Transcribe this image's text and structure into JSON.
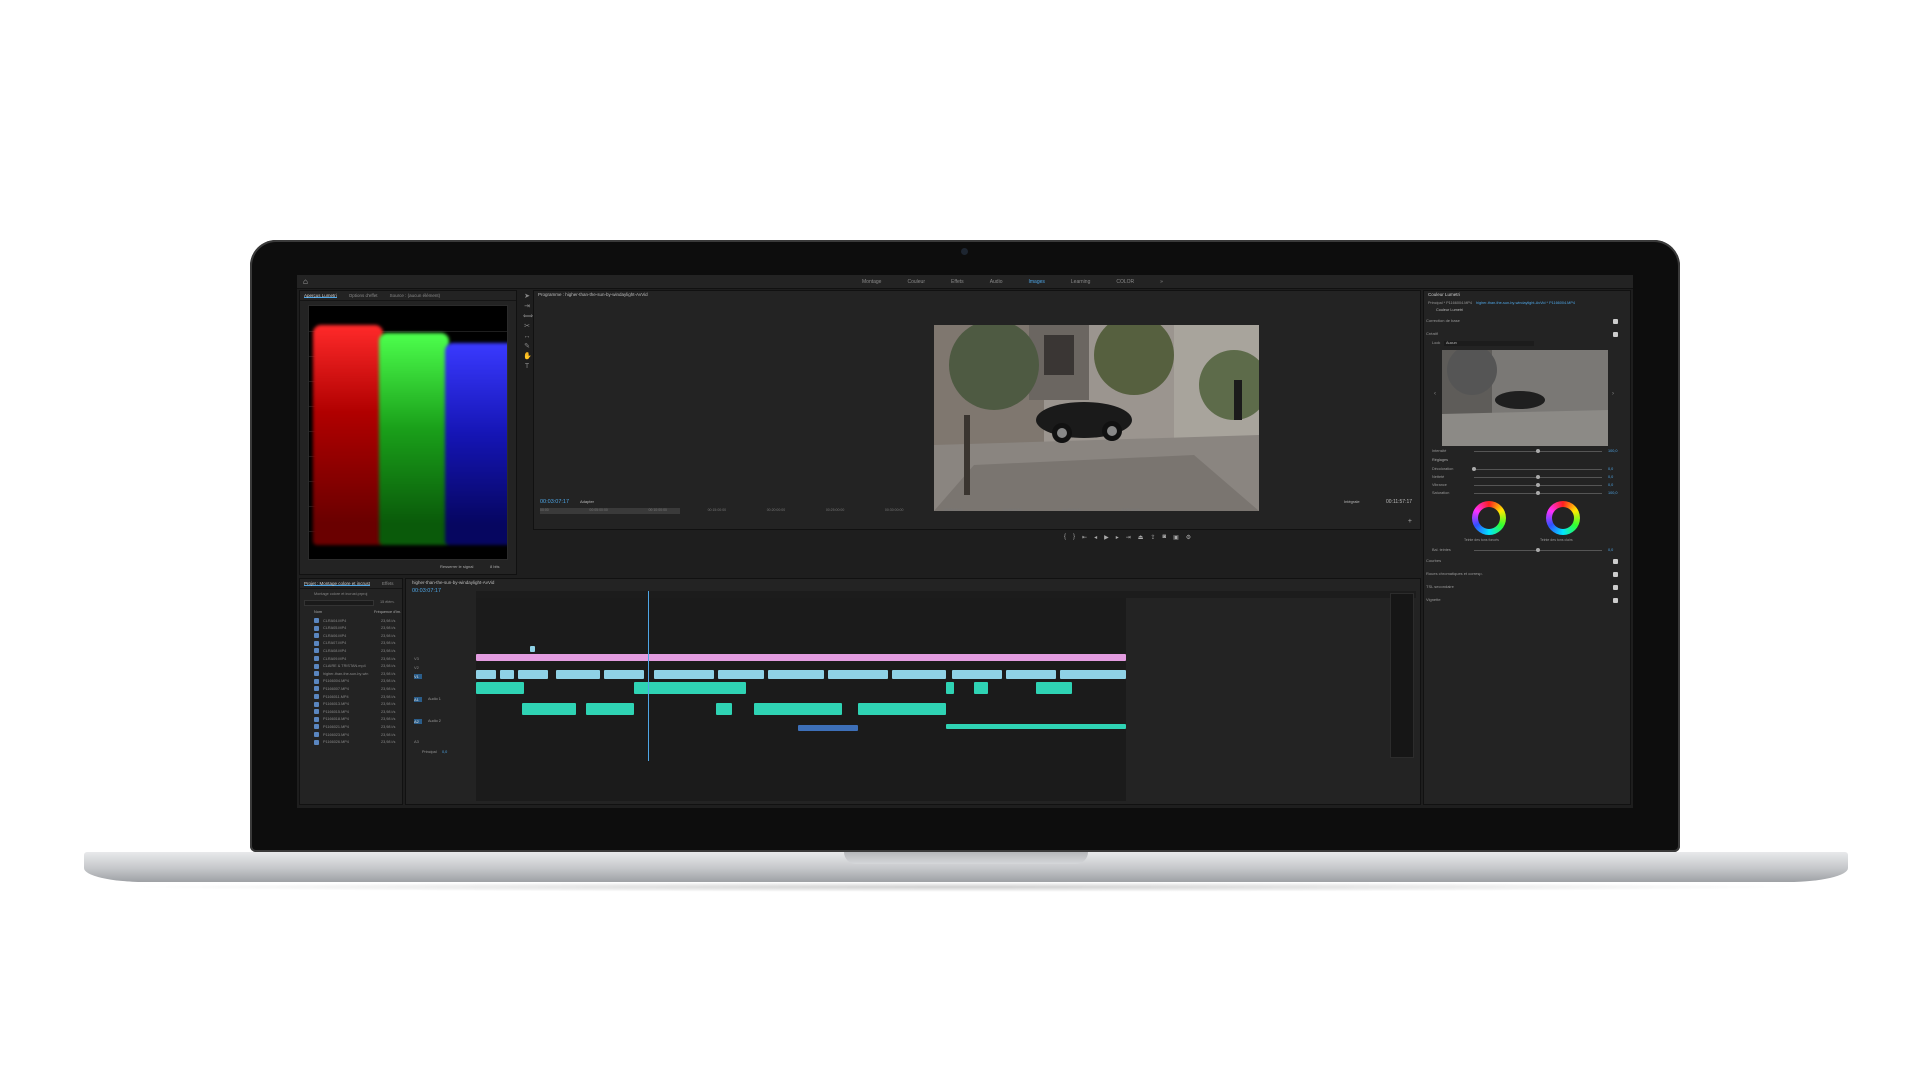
{
  "app": {
    "workspaces": [
      "Montage",
      "Couleur",
      "Effets",
      "Audio",
      "Images",
      "Learning",
      "COLOR"
    ],
    "active_workspace": "Images",
    "overflow": "»"
  },
  "scopes_panel": {
    "tabs": [
      "Aperçus Lumetri",
      "Options d'effet",
      "Source : (aucun élément)"
    ],
    "footer_label": "Resserrer le signal",
    "footer_value": "8 bits"
  },
  "program_monitor": {
    "title": "Programme : higher-than-the-sun-by-windaylight-AvVid",
    "timecode": "00:03:07:17",
    "fit": "Adapter",
    "quality": "Intégrale",
    "duration": "00:11:57:17",
    "ruler_ticks": [
      "00:00",
      "00:05:00:00",
      "00:10:00:00",
      "00:15:00:00",
      "00:20:00:00",
      "00:25:00:00",
      "00:30:00:00",
      "00:35:00:00",
      "00:40:00:00",
      "00:45:00:00",
      "00:50:00:00"
    ]
  },
  "project_panel": {
    "title": "Projet : Montage colore et incrust",
    "tab2": "Effets",
    "bin_label": "Montage colore et incrust.prproj",
    "count": "15 élém.",
    "col_name": "Nom",
    "col_rate": "Fréquence d'im.",
    "items": [
      {
        "name": "CLRA04.MP4",
        "rate": "23,98 i/s"
      },
      {
        "name": "CLRA05.MP4",
        "rate": "23,98 i/s"
      },
      {
        "name": "CLRA06.MP4",
        "rate": "23,98 i/s"
      },
      {
        "name": "CLRA07.MP4",
        "rate": "23,98 i/s"
      },
      {
        "name": "CLRA08.MP4",
        "rate": "23,98 i/s"
      },
      {
        "name": "CLRA09.MP4",
        "rate": "23,98 i/s"
      },
      {
        "name": "CLAIRE & TRISTAN.mp4",
        "rate": "23,98 i/s"
      },
      {
        "name": "higher-than-the-sun-by-win",
        "rate": "23,98 i/s"
      },
      {
        "name": "P1166004.MP4",
        "rate": "23,98 i/s"
      },
      {
        "name": "P1166007.MP4",
        "rate": "23,98 i/s"
      },
      {
        "name": "P1166011.MP4",
        "rate": "23,98 i/s"
      },
      {
        "name": "P1166013.MP4",
        "rate": "23,98 i/s"
      },
      {
        "name": "P1166015.MP4",
        "rate": "23,98 i/s"
      },
      {
        "name": "P1166018.MP4",
        "rate": "23,98 i/s"
      },
      {
        "name": "P1166021.MP4",
        "rate": "23,98 i/s"
      },
      {
        "name": "P1166023.MP4",
        "rate": "23,98 i/s"
      },
      {
        "name": "P1166026.MP4",
        "rate": "23,98 i/s"
      }
    ]
  },
  "timeline": {
    "title": "higher-than-the-sun-by-windaylight-AvVid",
    "timecode": "00:03:07:17",
    "track_labels": [
      "V3",
      "V2",
      "V1",
      "A1",
      "A2",
      "A3"
    ],
    "audio_labels": [
      "Audio 1",
      "Audio 2"
    ],
    "master": "Principal",
    "master_value": "0,0"
  },
  "lumetri": {
    "title": "Couleur Lumetri",
    "source": "Principal * P1166004.MP4",
    "clip": "higher-than-the-sun-by-windaylight-AvVid * P1166004.MP4",
    "effect": "Couleur Lumetri",
    "sections": [
      "Correction de base",
      "Créatif"
    ],
    "look_label": "Look",
    "look_value": "Aucun",
    "intensity_label": "Intensité",
    "intensity_value": "100,0",
    "adjust_label": "Réglages",
    "sliders": [
      {
        "label": "Décoloration",
        "value": "0,0",
        "level": 0.0
      },
      {
        "label": "Netteté",
        "value": "0,0",
        "level": 0.5
      },
      {
        "label": "Vibrance",
        "value": "0,0",
        "level": 0.5
      },
      {
        "label": "Saturation",
        "value": "100,0",
        "level": 0.5
      }
    ],
    "wheel_left": "Teinte des tons foncés",
    "wheel_right": "Teinte des tons clairs",
    "balance_label": "Bal. teintes",
    "balance_value": "0,0",
    "bottom_sections": [
      "Courbes",
      "Roues chromatiques et corresp.",
      "TSL secondaire",
      "Vignette"
    ]
  },
  "colors": {
    "accent": "#4ea6e6",
    "audio_clip": "#2fd3b4",
    "video_clip": "#8fd2e6",
    "adjust_layer": "#e39ce0"
  }
}
